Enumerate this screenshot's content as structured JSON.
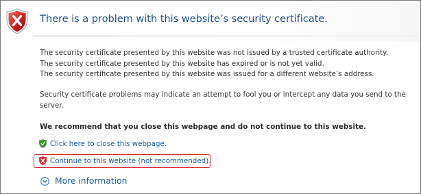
{
  "header": {
    "title": "There is a problem with this website’s security certificate."
  },
  "messages": {
    "line1": "The security certificate presented by this website was not issued by a trusted certificate authority.",
    "line2": "The security certificate presented by this website has expired or is not yet valid.",
    "line3": "The security certificate presented by this website was issued for a different website’s address.",
    "warning_line1": "Security certificate problems may indicate an attempt to fool you or intercept any data you send to the",
    "warning_line2": "server."
  },
  "recommendation": "We recommend that you close this webpage and do not continue to this website.",
  "actions": {
    "close_label": "Click here to close this webpage.",
    "close_icon": "green-shield-check-icon",
    "continue_label": "Continue to this website (not recommended).",
    "continue_icon": "red-shield-x-icon",
    "more_info_label": "More information",
    "more_info_icon": "circle-chevron-down-icon"
  },
  "colors": {
    "title": "#1f4e86",
    "link": "#1a5fa0",
    "danger": "#d8232a",
    "safe": "#3a9a2f"
  }
}
